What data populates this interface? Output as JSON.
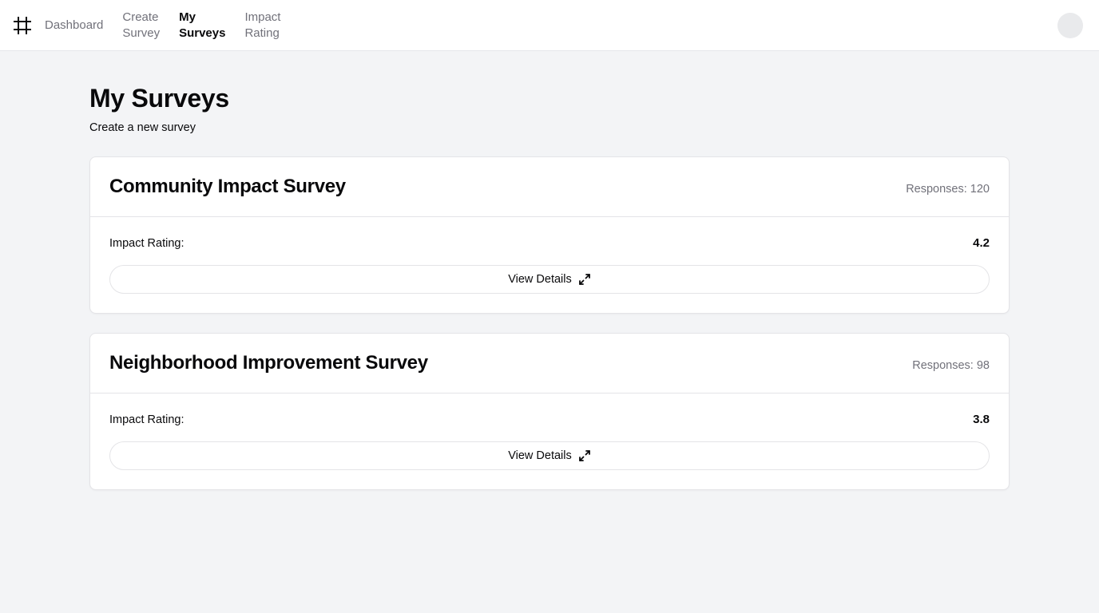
{
  "nav": {
    "logo_icon": "hash-icon",
    "links": [
      {
        "label_line1": "Dashboard",
        "label_line2": "",
        "active": false
      },
      {
        "label_line1": "Create",
        "label_line2": "Survey",
        "active": false
      },
      {
        "label_line1": "My",
        "label_line2": "Surveys",
        "active": true
      },
      {
        "label_line1": "Impact",
        "label_line2": "Rating",
        "active": false
      }
    ],
    "avatar_icon": "user-avatar-icon"
  },
  "page": {
    "title": "My Surveys",
    "subtitle": "Create a new survey"
  },
  "surveys": [
    {
      "title": "Community Impact Survey",
      "responses": "Responses: 120",
      "rating_label": "Impact Rating:",
      "rating_value": "4.2",
      "button_label": "View Details",
      "button_icon": "expand-arrows-icon"
    },
    {
      "title": "Neighborhood Improvement Survey",
      "responses": "Responses: 98",
      "rating_label": "Impact Rating:",
      "rating_value": "3.8",
      "button_label": "View Details",
      "button_icon": "expand-arrows-icon"
    }
  ],
  "colors": {
    "background": "#f3f4f6",
    "card": "#ffffff",
    "text": "#09090b",
    "muted_text": "#71717a",
    "border": "#e4e4e7"
  }
}
